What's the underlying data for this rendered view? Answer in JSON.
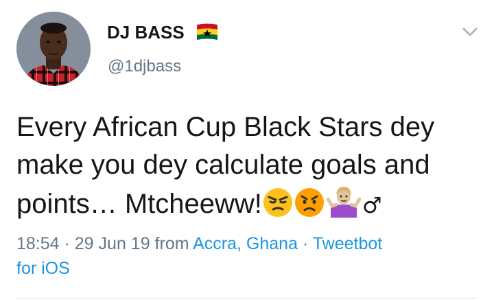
{
  "user": {
    "display_name": "DJ BASS",
    "handle": "@1djbass",
    "flag_icon": "ghana-flag-icon",
    "avatar": "avatar-photo"
  },
  "tweet": {
    "text_line_1": "Every African Cup Black Stars dey",
    "text_line_2": "make you dey calculate goals and",
    "text_line_3": "points… Mtcheeww!",
    "emojis": [
      "unamused-face-emoji",
      "pouting-face-emoji",
      "shrugging-person-emoji",
      "male-sign-emoji"
    ],
    "male_sign": "♂"
  },
  "meta": {
    "time": "18:54",
    "separator_1": " · ",
    "date": "29 Jun 19",
    "from_word": " from ",
    "location": "Accra, Ghana",
    "separator_2": " · ",
    "client_part_1": "Tweetbot",
    "client_part_2": "for iOS"
  },
  "colors": {
    "text": "#14171a",
    "secondary": "#657786",
    "link": "#1b95e0",
    "divider": "#e1e8ed"
  }
}
